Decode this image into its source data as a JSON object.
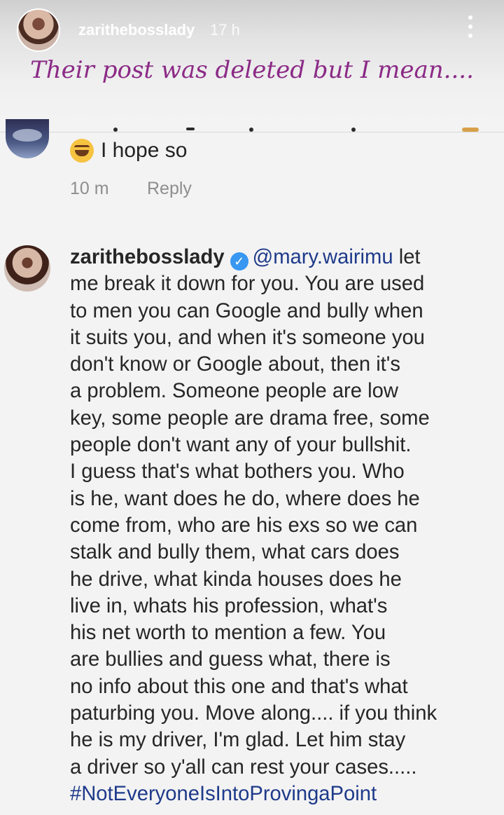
{
  "story": {
    "username": "zarithebosslady",
    "time": "17 h",
    "caption": "Their post was deleted but I mean...."
  },
  "previous_comment": {
    "emoji": "laughing-tears-emoji",
    "text": "I hope so",
    "time": "10 m",
    "reply_label": "Reply"
  },
  "comment": {
    "username": "zarithebosslady",
    "mention": "@mary.wairimu",
    "lines": [
      " let",
      "me break it down for you. You are used",
      "to men you can Google and bully when",
      "it suits you, and when it's someone you",
      "don't know or Google about, then it's",
      "a problem. Someone people are low",
      "key, some people are drama free, some",
      "people don't want any of your bullshit.",
      "I guess that's what bothers you. Who",
      "is he, want does he do, where does he",
      "come from, who are his exs so we can",
      "stalk and bully them, what cars does",
      "he drive, what kinda houses does he",
      "live in, whats his profession, what's",
      "his net worth to mention a few. You",
      "are bullies and guess what, there is",
      "no info about this one and that's what",
      "paturbing you. Move along.... if you think",
      "he is my driver, I'm glad. Let him stay",
      "a driver so y'all can rest your cases....."
    ],
    "hashtag": "#NotEveryoneIsIntoProvingaPoint"
  },
  "colors": {
    "caption": "#8b2a86",
    "mention": "#1e3a8a",
    "verified": "#3897f0"
  }
}
